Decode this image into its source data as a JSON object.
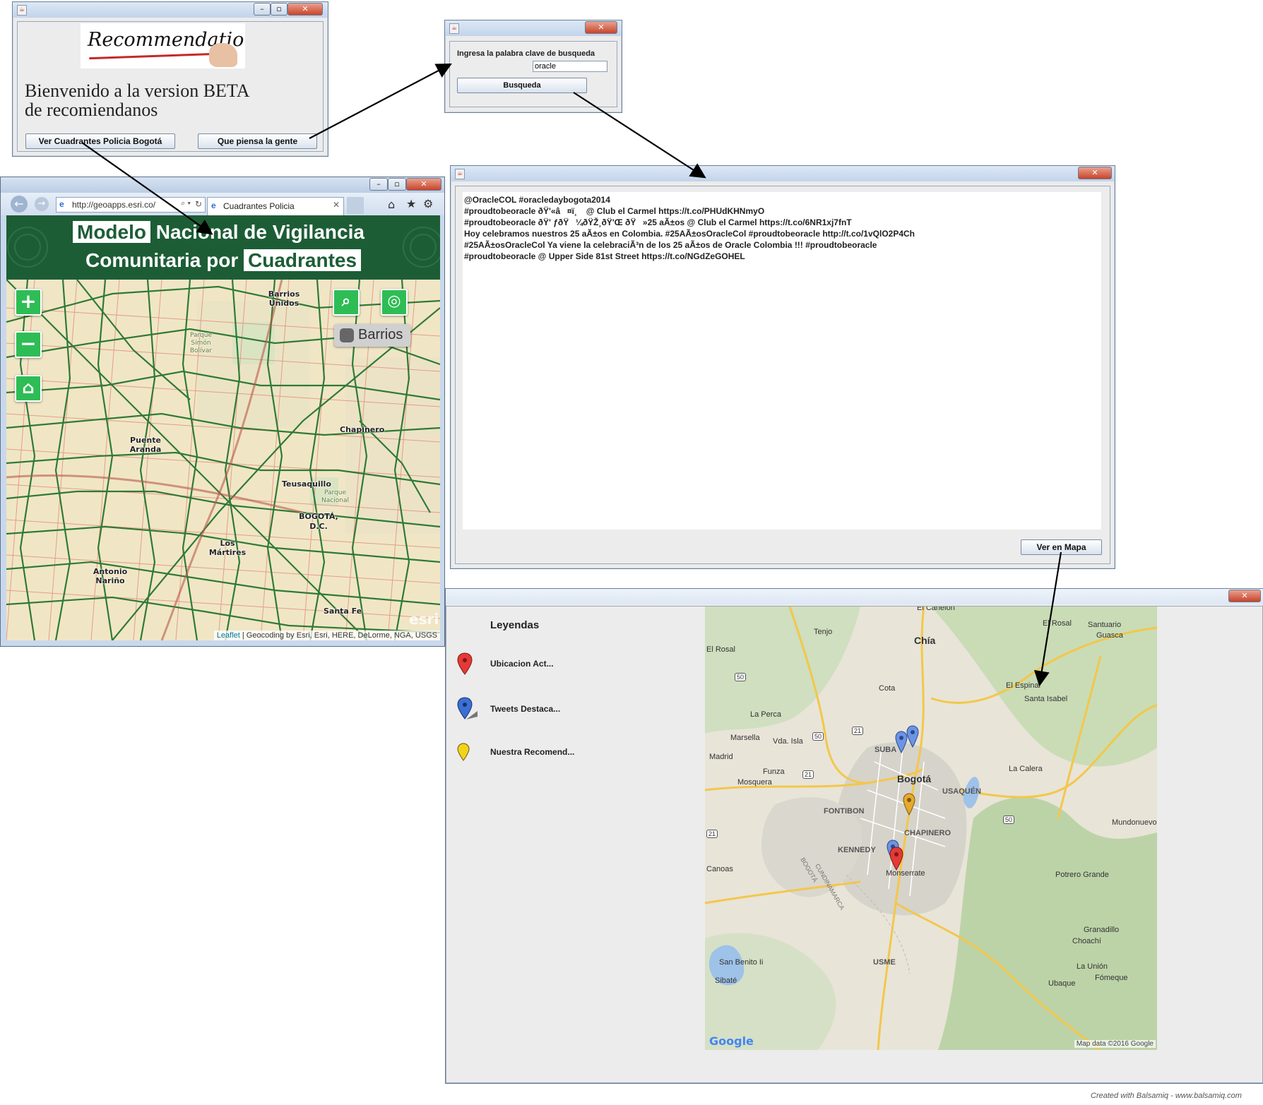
{
  "welcome_window": {
    "logo_text": "Recommendation",
    "greeting_line1": "Bienvenido a la version BETA",
    "greeting_line2": "de recomiendanos",
    "btn_cuadrantes": "Ver Cuadrantes Policia Bogotá",
    "btn_gente": "Que piensa la gente"
  },
  "search_window": {
    "prompt": "Ingresa la palabra clave de busqueda",
    "input_value": "oracle",
    "search_button": "Busqueda"
  },
  "browser_window": {
    "url": "http://geoapps.esri.co/",
    "tab_title": "Cuadrantes Policia",
    "banner": {
      "word1": "Modelo",
      "word2": "Nacional de Vigilancia",
      "word3": "Comunitaria por",
      "word4": "Cuadrantes"
    },
    "barrios_toggle": "Barrios",
    "place_labels": {
      "barrios_unidos": "Barrios Unidos",
      "parque_simon": "Parque Simón Bolívar",
      "chapinero": "Chapinero",
      "puente_aranda": "Puente Aranda",
      "teusaquillo": "Teusaquillo",
      "parque_nacional": "Parque Nacional",
      "bogota_dc": "BOGOTÁ, D.C.",
      "los_martires": "Los Mártires",
      "antonio_narino": "Antonio Nariño",
      "santa_fe": "Santa Fe"
    },
    "watermark": "esri",
    "attribution_link": "Leaflet",
    "attribution_text": " | Geocoding by Esri, Esri, HERE, DeLorme, NGA, USGS"
  },
  "tweets_window": {
    "tweets": [
      "@OracleCOL #oracledaybogota2014",
      "#proudtobeoracle ðŸ'«â¤ï¸ @ Club el Carmel https://t.co/PHUdKHNmyO",
      "#proudtobeoracle ðŸ' ƒðŸ¼ðŸŽ¸ðŸ'Œ ðŸ»25 aÃ±os @ Club el Carmel https://t.co/6NR1xj7fnT",
      "Hoy celebramos nuestros 25 aÃ±os en Colombia. #25AÃ±osOracleCol #proudtobeoracle http://t.co/1vQlO2P4Ch",
      "#25AÃ±osOracleCol Ya viene la celebraciÃ³n de los 25 aÃ±os de Oracle Colombia !!! #proudtobeoracle",
      "#proudtobeoracle @ Upper Side 81st Street https://t.co/NGdZeGOHEL"
    ],
    "map_button": "Ver en Mapa"
  },
  "map_window": {
    "legend_title": "Leyendas",
    "legend_items": [
      {
        "label": "Ubicacion Act...",
        "color": "#e53935"
      },
      {
        "label": "Tweets Destaca...",
        "color": "#3b6fd4"
      },
      {
        "label": "Nuestra Recomend...",
        "color": "#f2d31b"
      }
    ],
    "places": {
      "el_canelon": "El Canelón",
      "el_rosal_ne": "El Rosal",
      "santuario": "Santuario",
      "guasca": "Guasca",
      "tenjo": "Tenjo",
      "chia": "Chía",
      "el_rosal_w": "El Rosal",
      "el_espinal": "El Espinal",
      "santa_isabel": "Santa Isabel",
      "cota": "Cota",
      "la_perca": "La Perca",
      "marsella": "Marsella",
      "vda_isla": "Vda. Isla",
      "madrid": "Madrid",
      "suba": "SUBA",
      "funza": "Funza",
      "mosquera": "Mosquera",
      "bogota": "Bogotá",
      "usaquen": "USAQUÉN",
      "la_calera": "La Calera",
      "fontibon": "FONTIBON",
      "mundonuevo": "Mundonuevo",
      "chapinero": "CHAPINERO",
      "kennedy": "KENNEDY",
      "monserrate": "Monserrate",
      "canoas": "Canoas",
      "bogota_river": "BOGOTÁ",
      "cundinamarca": "CUNDINAMARCA",
      "potrero_grande": "Potrero Grande",
      "granadillo": "Granadillo",
      "choachi": "Choachí",
      "san_benito": "San Benito Ii",
      "usme": "USME",
      "la_union": "La Unión",
      "fomeque": "Fómeque",
      "sibate": "Sibaté",
      "ubaque": "Ubaque"
    },
    "road_shields": [
      "50",
      "50",
      "21",
      "21",
      "50",
      "21"
    ],
    "google_logo": "Google",
    "map_data": "Map data ©2016 Google"
  },
  "footer": "Created with Balsamiq - www.balsamiq.com",
  "colors": {
    "banner_green": "#1d5d36",
    "quadrant_line": "#2f7a35",
    "map_button_green": "#2ebd55",
    "arrow": "#000000"
  }
}
